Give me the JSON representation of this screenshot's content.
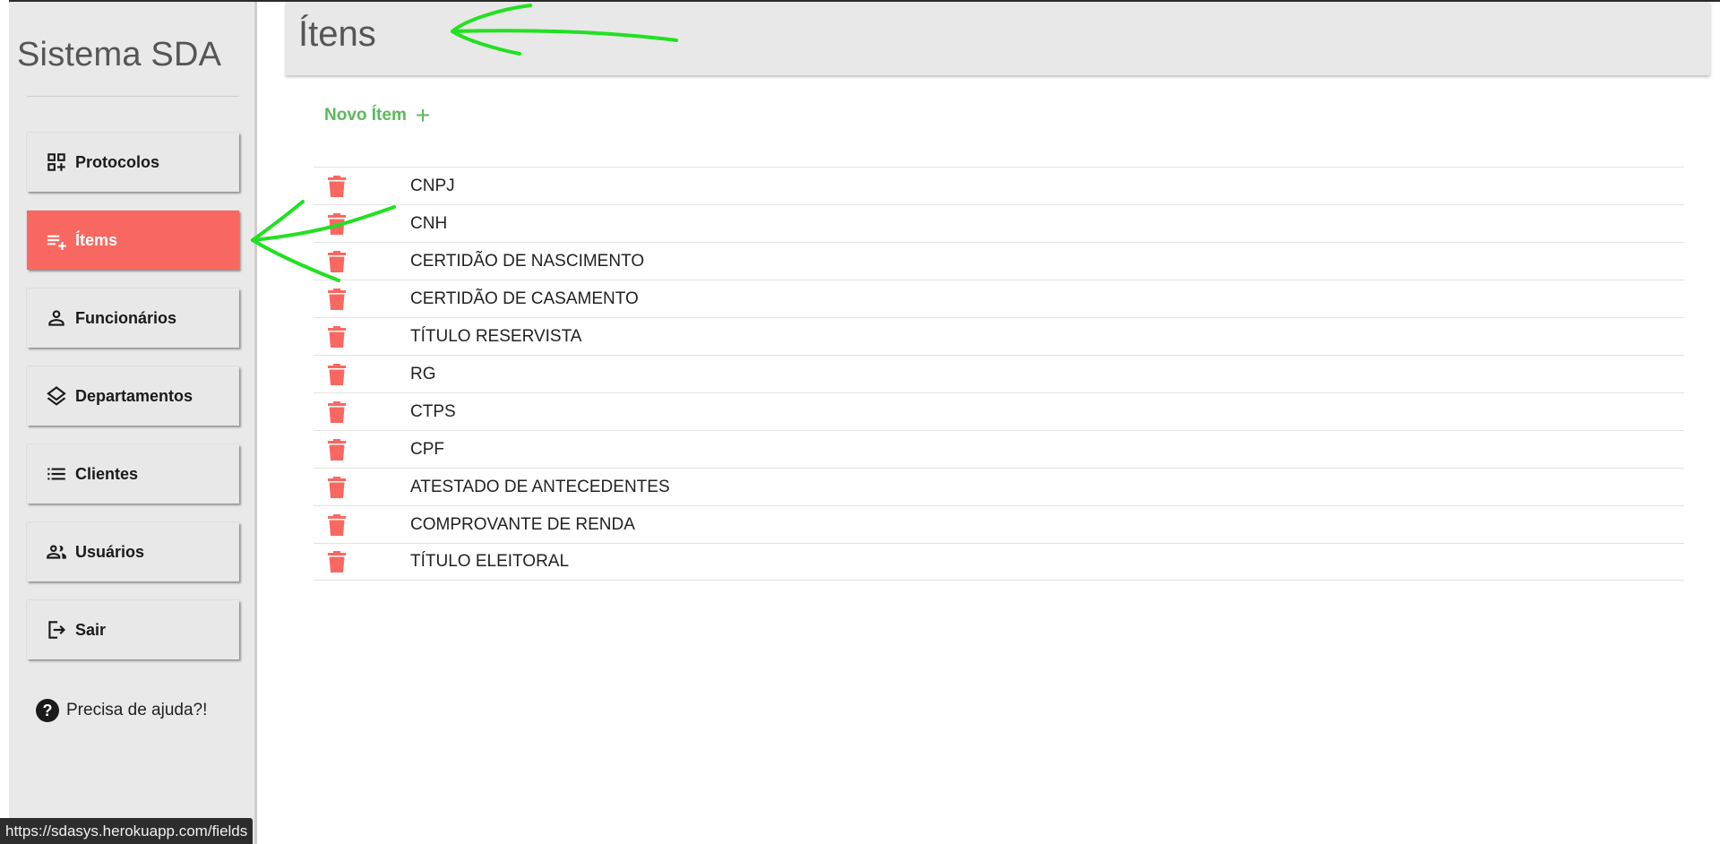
{
  "app": {
    "brand": "Sistema SDA"
  },
  "sidebar": {
    "items": [
      {
        "label": "Protocolos",
        "icon": "grid-add-icon",
        "active": false
      },
      {
        "label": "Ítems",
        "icon": "playlist-add-icon",
        "active": true
      },
      {
        "label": "Funcionários",
        "icon": "person-icon",
        "active": false
      },
      {
        "label": "Departamentos",
        "icon": "layers-icon",
        "active": false
      },
      {
        "label": "Clientes",
        "icon": "list-icon",
        "active": false
      },
      {
        "label": "Usuários",
        "icon": "people-icon",
        "active": false
      },
      {
        "label": "Sair",
        "icon": "logout-icon",
        "active": false
      }
    ],
    "help": "Precisa de ajuda?!"
  },
  "header": {
    "title": "Ítens"
  },
  "main": {
    "new_item_label": "Novo Ítem",
    "items": [
      "CNPJ",
      "CNH",
      "CERTIDÃO DE NASCIMENTO",
      "CERTIDÃO DE CASAMENTO",
      "TÍTULO RESERVISTA",
      "RG",
      "CTPS",
      "CPF",
      "ATESTADO DE ANTECEDENTES",
      "COMPROVANTE DE RENDA",
      "TÍTULO ELEITORAL"
    ]
  },
  "status_bar": {
    "url": "https://sdasys.herokuapp.com/fields"
  },
  "colors": {
    "accent": "#f96860",
    "new_item": "#5cb85c",
    "sidebar_bg": "#e9e9e9",
    "annotation": "#22e022"
  }
}
